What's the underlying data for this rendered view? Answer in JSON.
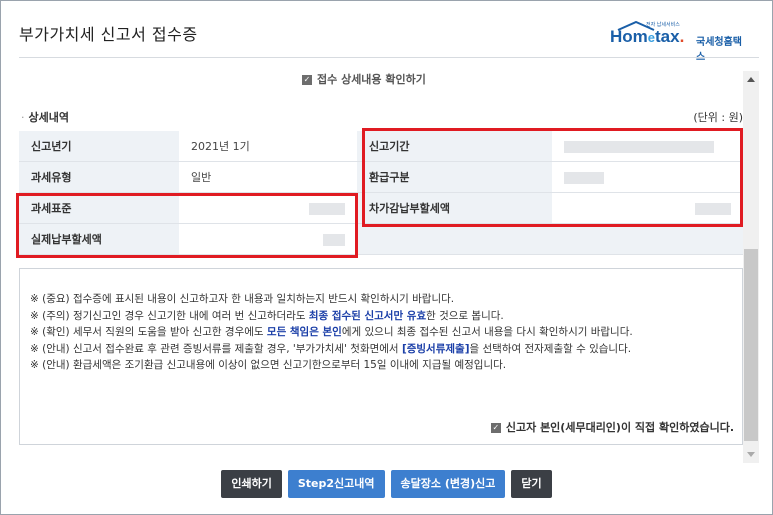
{
  "header": {
    "title": "부가가치세 신고서 접수증",
    "logo": {
      "text_main": "Hom",
      "text_e": "e",
      "text_tax": "tax",
      "text_sub": "국세청홈택스",
      "tiny": "전자 납세서비스"
    }
  },
  "confirm_top": "접수 상세내용 확인하기",
  "section": {
    "title": "상세내역",
    "unit": "(단위 : 원)"
  },
  "table": {
    "rows": [
      {
        "l1": "신고년기",
        "v1": "2021년 1기",
        "l2": "신고기간",
        "v2": ""
      },
      {
        "l1": "과세유형",
        "v1": "일반",
        "l2": "환급구분",
        "v2": ""
      },
      {
        "l1": "과세표준",
        "v1": "",
        "l2": "차가감납부할세액",
        "v2": ""
      },
      {
        "l1": "실제납부할세액",
        "v1": "",
        "l2": "",
        "v2": ""
      }
    ]
  },
  "notice": {
    "l1": "※ (중요) 접수증에 표시된 내용이 신고하고자 한 내용과 일치하는지 반드시 확인하시기 바랍니다.",
    "l2a": "※ (주의) 정기신고인 경우 신고기한 내에 여러 번 신고하더라도 ",
    "l2b": "최종 접수된 신고서만 유효",
    "l2c": "한 것으로 봅니다.",
    "l3a": "※ (확인) 세무서 직원의 도움을 받아 신고한 경우에도 ",
    "l3b": "모든 책임은 본인",
    "l3c": "에게 있으니 최종 접수된 신고서 내용을 다시 확인하시기 바랍니다.",
    "l4a": "※ (안내) 신고서 접수완료 후 관련 증빙서류를 제출할 경우, '부가가치세' 첫화면에서 ",
    "l4b": "[증빙서류제출]",
    "l4c": "을 선택하여 전자제출할 수 있습니다.",
    "l5": "※ (안내) 환급세액은 조기환급 신고내용에 이상이 없으면 신고기한으로부터 15일 이내에 지급될 예정입니다.",
    "confirm": "신고자 본인(세무대리인)이 직접 확인하였습니다."
  },
  "buttons": {
    "print": "인쇄하기",
    "step2": "Step2신고내역",
    "address": "송달장소 (변경)신고",
    "close": "닫기"
  },
  "colors": {
    "highlight_box": "#e01b22",
    "accent_blue": "#3d7fcf",
    "link_text": "#1b3fa8"
  }
}
